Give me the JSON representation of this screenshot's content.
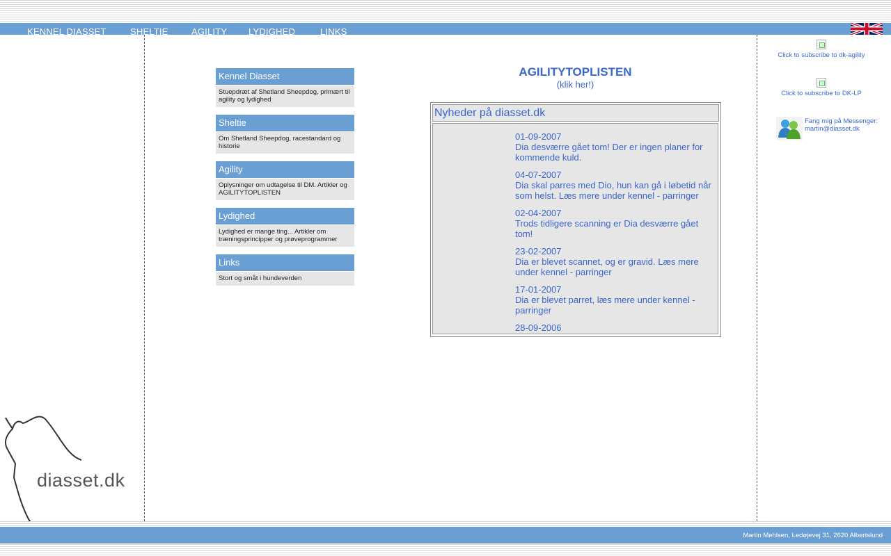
{
  "nav": {
    "items": [
      {
        "label": "KENNEL DIASSET"
      },
      {
        "label": "SHELTIE"
      },
      {
        "label": "AGILITY"
      },
      {
        "label": "LYDIGHED"
      },
      {
        "label": "LINKS"
      }
    ],
    "flag_icon": "uk-flag-icon"
  },
  "menu": [
    {
      "title": "Kennel Diasset",
      "desc": "Stuepdræt af Shetland Sheepdog, primært til agility og lydighed"
    },
    {
      "title": "Sheltie",
      "desc": "Om Shetland Sheepdog, racestandard og historie"
    },
    {
      "title": "Agility",
      "desc": "Oplysninger om udtagelse til DM. Artikler og AGILITYTOPLISTEN"
    },
    {
      "title": "Lydighed",
      "desc": "Lydighed er mange ting... Artikler om træningsprincipper og prøveprogrammer"
    },
    {
      "title": "Links",
      "desc": "Stort og småt i hundeverden"
    }
  ],
  "agility": {
    "title": "AGILITYTOPLISTEN",
    "link": "(klik her!)"
  },
  "news": {
    "header": "Nyheder på diasset.dk",
    "entries": [
      {
        "date": "01-09-2007",
        "text": "Dia desværre gået tom! Der er ingen planer for kommende kuld."
      },
      {
        "date": "04-07-2007",
        "text": "Dia skal parres med Dio, hun kan gå i løbetid når som helst. Læs mere under kennel - parringer"
      },
      {
        "date": "02-04-2007",
        "text": "Trods tidligere scanning er Dia desværre gået tom!"
      },
      {
        "date": "23-02-2007",
        "text": "Dia er blevet scannet, og er gravid. Læs mere under kennel - parringer"
      },
      {
        "date": "17-01-2007",
        "text": "Dia er blevet parret, læs mere under kennel - parringer"
      },
      {
        "date": "28-09-2006",
        "text": ""
      }
    ]
  },
  "sidebar": {
    "subscribe_agility": "Click to subscribe to dk-agility",
    "subscribe_lp": "Click to subscribe to DK-LP",
    "messenger": "Fang mig på Messenger: martin@diasset.dk"
  },
  "logo": {
    "text": "diasset.dk"
  },
  "footer": {
    "text": "Martin Mehlsen, Ledøjevej 31, 2620 Albertslund"
  },
  "colors": {
    "nav_blue": "#6a9fd4",
    "link_blue": "#3a66cc",
    "panel_gray": "#e6e6e6"
  }
}
